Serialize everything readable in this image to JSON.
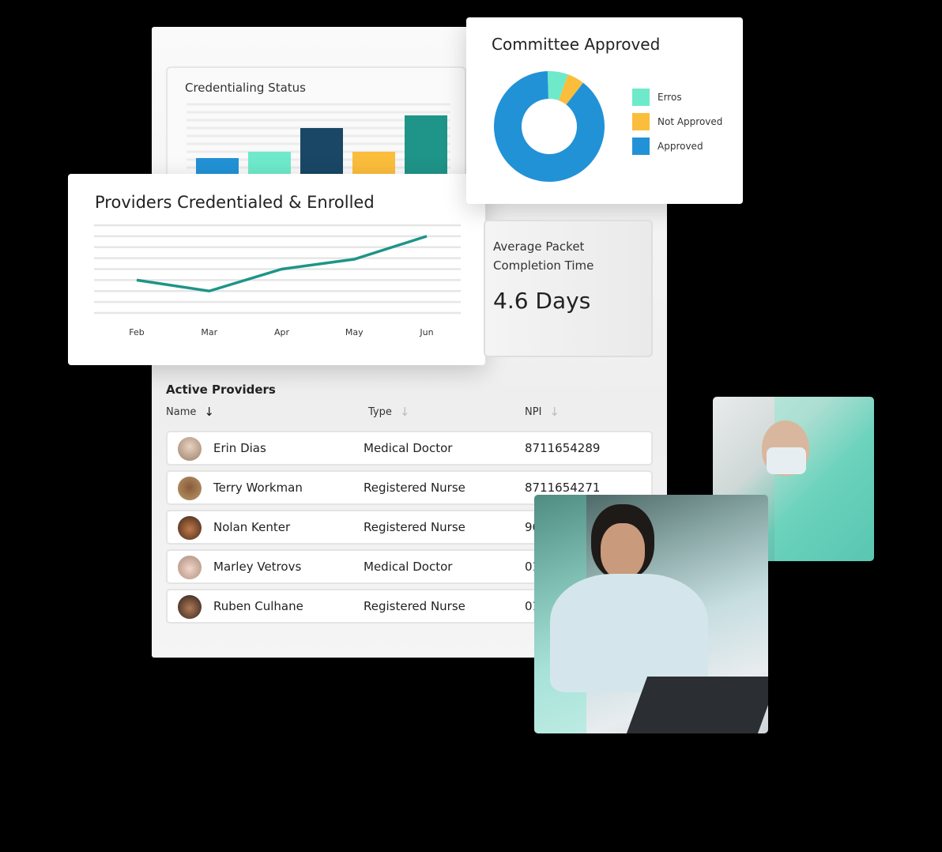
{
  "credentialing_status": {
    "title": "Credentialing Status",
    "chart_data": {
      "type": "bar",
      "title": "Credentialing Status",
      "values": [
        22,
        30,
        60,
        30,
        76
      ],
      "colors": [
        "#2292d6",
        "#6eeacb",
        "#1a4766",
        "#fbbd3c",
        "#1f9488"
      ],
      "ylim": [
        0,
        100
      ],
      "grid": true
    }
  },
  "committee_approved": {
    "title": "Committee Approved",
    "chart_data": {
      "type": "pie",
      "title": "Committee Approved",
      "donut": true,
      "slices": [
        {
          "name": "Erros",
          "value": 6,
          "color": "#6eeacb"
        },
        {
          "name": "Not Approved",
          "value": 5,
          "color": "#fbbd3c"
        },
        {
          "name": "Approved",
          "value": 89,
          "color": "#2292d6"
        }
      ],
      "legend": "right"
    }
  },
  "providers_enrolled": {
    "title": "Providers Credentialed & Enrolled",
    "chart_data": {
      "type": "line",
      "title": "Providers Credentialed & Enrolled",
      "categories": [
        "Feb",
        "Mar",
        "Apr",
        "May",
        "Jun"
      ],
      "values": [
        3.0,
        2.0,
        4.0,
        4.9,
        7.0
      ],
      "ylim": [
        0,
        8
      ],
      "color": "#1f9488",
      "grid": true
    }
  },
  "avg_packet": {
    "label_line1": "Average Packet",
    "label_line2": "Completion Time",
    "value": "4.6 Days"
  },
  "active_providers": {
    "title": "Active Providers",
    "columns": [
      "Name",
      "Type",
      "NPI"
    ],
    "rows": [
      {
        "name": "Erin Dias",
        "type": "Medical Doctor",
        "npi": "8711654289"
      },
      {
        "name": "Terry Workman",
        "type": "Registered Nurse",
        "npi": "8711654271"
      },
      {
        "name": "Nolan Kenter",
        "type": "Registered Nurse",
        "npi": "96"
      },
      {
        "name": "Marley Vetrovs",
        "type": "Medical Doctor",
        "npi": "01"
      },
      {
        "name": "Ruben Culhane",
        "type": "Registered Nurse",
        "npi": "01"
      }
    ]
  }
}
